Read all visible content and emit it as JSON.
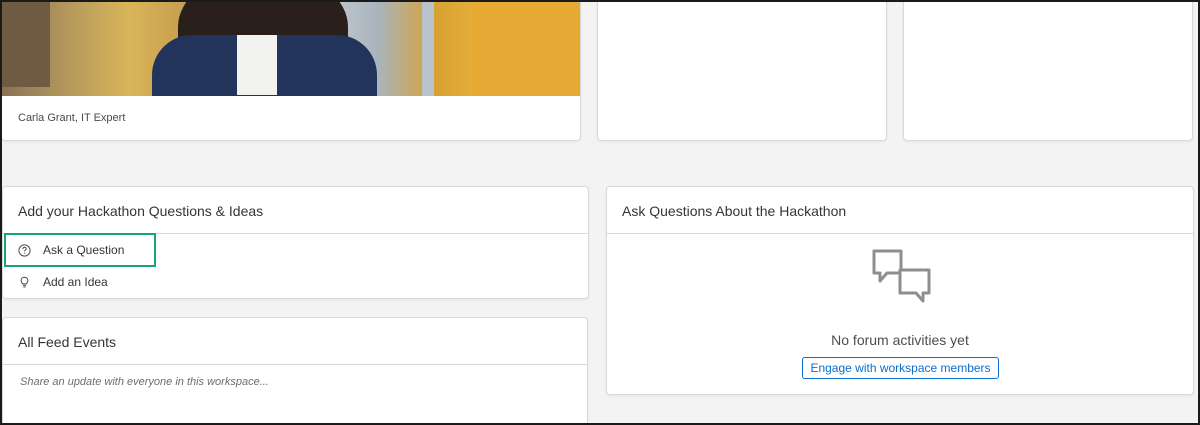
{
  "profile_card": {
    "caption": "Carla Grant, IT Expert"
  },
  "qa_card": {
    "title": "Add your Hackathon Questions & Ideas",
    "actions": [
      {
        "label": "Ask a Question",
        "icon": "question-circle-icon"
      },
      {
        "label": "Add an Idea",
        "icon": "lightbulb-icon"
      }
    ]
  },
  "feed_card": {
    "title": "All Feed Events",
    "share_placeholder": "Share an update with everyone in this workspace..."
  },
  "forum_card": {
    "title": "Ask Questions About the Hackathon",
    "icon": "discussion-bubbles-icon",
    "empty_text": "No forum activities yet",
    "engage_button": "Engage with workspace members"
  },
  "colors": {
    "highlight": "#1aa07a",
    "link_blue": "#0a6ed1",
    "background": "#f3f3f3"
  }
}
